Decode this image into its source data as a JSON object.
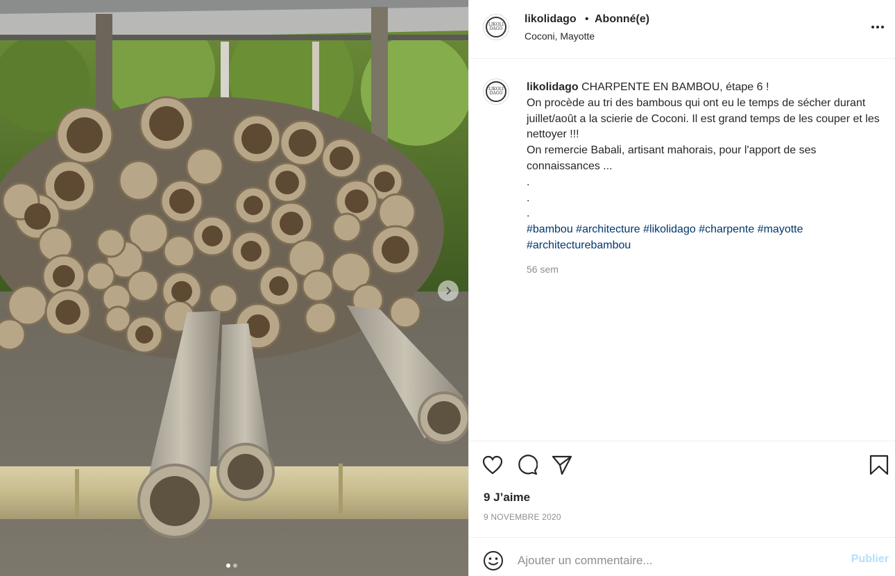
{
  "header": {
    "username": "likolidago",
    "separator": "•",
    "follow_status": "Abonné(e)",
    "location": "Coconi, Mayotte",
    "avatar_text": [
      "LIKOLI",
      "DAGO"
    ]
  },
  "caption": {
    "username": "likolidago",
    "lines": [
      "CHARPENTE EN BAMBOU, étape 6 !",
      "On procède au tri des bambous qui ont eu le temps de sécher durant juillet/août a la scierie de Coconi. Il est grand temps de les couper et les nettoyer !!!",
      "On remercie Babali, artisant mahorais, pour l'apport de ses connaissances ...",
      ".",
      ".",
      "."
    ],
    "hashtags": [
      "#bambou",
      "#architecture",
      "#likolidago",
      "#charpente",
      "#mayotte",
      "#architecturebambou"
    ],
    "age": "56 sem"
  },
  "actions": {
    "icons": [
      "heart-icon",
      "comment-icon",
      "share-icon",
      "bookmark-icon"
    ],
    "likes": "9 J’aime",
    "date": "9 NOVEMBRE 2020"
  },
  "comment": {
    "placeholder": "Ajouter un commentaire...",
    "publish_label": "Publier"
  },
  "carousel": {
    "slides": 2,
    "current": 1
  },
  "colors": {
    "link": "#00376b",
    "publish_disabled": "#b2dffc",
    "muted": "#8e8e8e",
    "border": "#efefef"
  }
}
